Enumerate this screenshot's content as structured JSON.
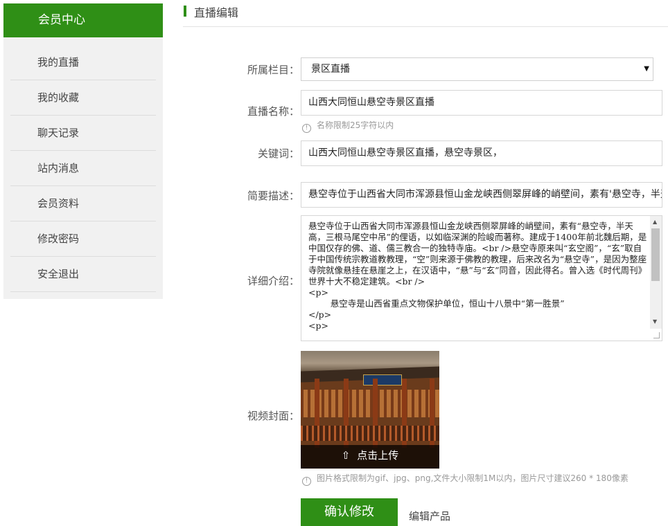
{
  "sidebar": {
    "title": "会员中心",
    "items": [
      {
        "label": "我的直播"
      },
      {
        "label": "我的收藏"
      },
      {
        "label": "聊天记录"
      },
      {
        "label": "站内消息"
      },
      {
        "label": "会员资料"
      },
      {
        "label": "修改密码"
      },
      {
        "label": "安全退出"
      }
    ]
  },
  "page": {
    "title": "直播编辑"
  },
  "form": {
    "category": {
      "label": "所属栏目：",
      "value": "景区直播"
    },
    "name": {
      "label": "直播名称：",
      "value": "山西大同恒山悬空寺景区直播",
      "hint": "名称限制25字符以内"
    },
    "keywords": {
      "label": "关键词：",
      "value": "山西大同恒山悬空寺景区直播，悬空寺景区，"
    },
    "summary": {
      "label": "简要描述：",
      "value": "悬空寺位于山西省大同市浑源县恒山金龙峡西侧翠屏峰的峭壁间，素有'悬空寺，半天高"
    },
    "detail": {
      "label": "详细介绍：",
      "value": "悬空寺位于山西省大同市浑源县恒山金龙峡西侧翠屏峰的峭壁间，素有“悬空寺，半天高，三根马尾空中吊”的俚语，以如临深渊的险峻而著称。建成于1400年前北魏后期，是中国仅存的佛、道、儒三教合一的独特寺庙。<br />悬空寺原来叫“玄空阁”，“玄”取自于中国传统宗教道教教理，“空”则来源于佛教的教理，后来改名为“悬空寺”，是因为整座寺院就像悬挂在悬崖之上，在汉语中，“悬”与“玄”同音，因此得名。曾入选《时代周刊》世界十大不稳定建筑。<br />\n<p>\n\t悬空寺是山西省重点文物保护单位，恒山十八景中“第一胜景”\n</p>\n<p>"
    },
    "cover": {
      "label": "视频封面：",
      "upload_label": "点击上传",
      "hint": "图片格式限制为gif、jpg、png,文件大小限制1M以内，图片尺寸建议260 * 180像素"
    }
  },
  "actions": {
    "confirm": "确认修改",
    "edit_product": "编辑产品"
  },
  "colors": {
    "accent": "#2f8f16",
    "sidebar_bg": "#f1f1f1"
  },
  "icons": {
    "hint": "info-circle-icon",
    "upload": "upload-icon",
    "select": "caret-down-icon"
  }
}
